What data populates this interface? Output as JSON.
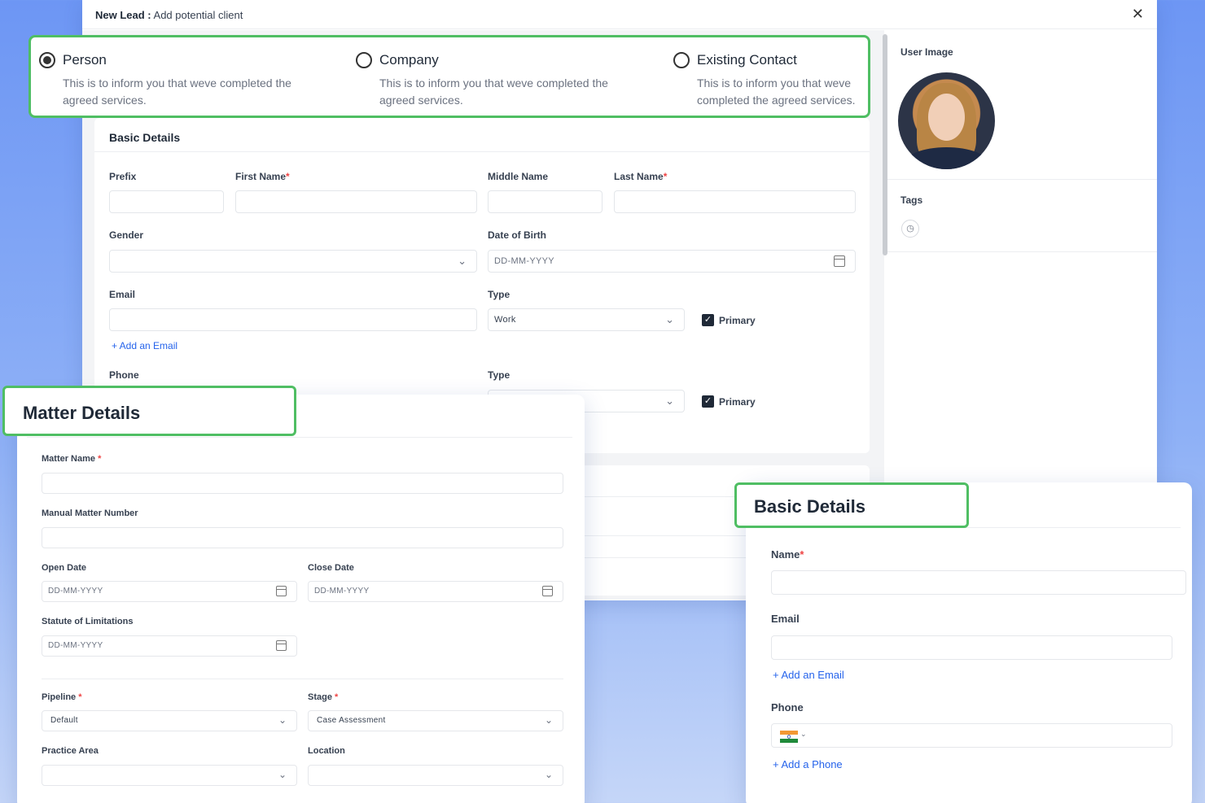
{
  "modal": {
    "title_bold": "New Lead :",
    "title_rest": " Add potential client",
    "close": "✕"
  },
  "lead_type": [
    {
      "label": "Person",
      "desc": "This is to inform you that weve completed the agreed services.",
      "selected": true
    },
    {
      "label": "Company",
      "desc": "This is to inform you that weve completed the agreed services.",
      "selected": false
    },
    {
      "label": "Existing Contact",
      "desc": "This is to inform you that weve completed the agreed services.",
      "selected": false
    }
  ],
  "basic": {
    "title": "Basic Details",
    "prefix": "Prefix",
    "first_name": "First Name",
    "middle_name": "Middle Name",
    "last_name": "Last Name",
    "gender": "Gender",
    "dob": "Date of Birth",
    "dob_placeholder": "DD-MM-YYYY",
    "email": "Email",
    "type": "Type",
    "email_type_value": "Work",
    "primary": "Primary",
    "add_email": "+ Add an Email",
    "phone": "Phone",
    "phone_type": "Type",
    "primary2": "Primary"
  },
  "side": {
    "user_image": "User Image",
    "tags": "Tags"
  },
  "matter": {
    "title": "Matter Details",
    "matter_name": "Matter Name",
    "manual_number": "Manual Matter Number",
    "open_date": "Open Date",
    "close_date": "Close Date",
    "statute": "Statute of Limitations",
    "date_ph": "DD-MM-YYYY",
    "pipeline": "Pipeline",
    "pipeline_value": "Default",
    "stage": "Stage",
    "stage_value": "Case Assessment",
    "practice_area": "Practice Area",
    "location": "Location"
  },
  "basic2": {
    "title": "Basic Details",
    "name": "Name",
    "email": "Email",
    "add_email": "+ Add an Email",
    "phone": "Phone",
    "add_phone": "+ Add a Phone"
  },
  "colors": {
    "accent_green": "#4fbe63",
    "link_blue": "#2563eb"
  }
}
